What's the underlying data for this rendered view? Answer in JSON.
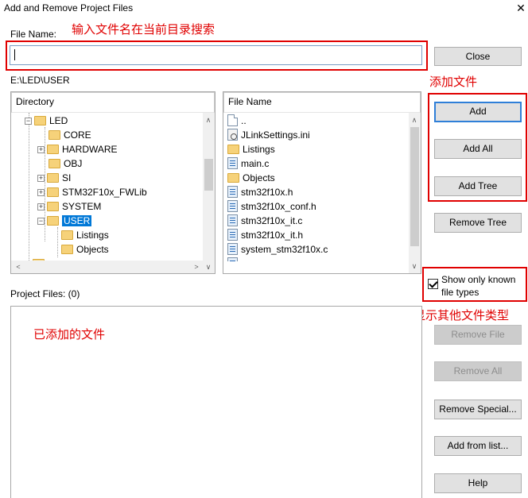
{
  "window": {
    "title": "Add and Remove Project Files",
    "close_glyph": "✕"
  },
  "annotations": {
    "filename": "输入文件名在当前目录搜索",
    "add_file": "添加文件",
    "filetype": "选择显示其他文件类型",
    "added": "已添加的文件"
  },
  "file_name": {
    "label": "File Name:",
    "value": ""
  },
  "current_path": "E:\\LED\\USER",
  "directory": {
    "header": "Directory",
    "items": [
      {
        "label": "LED",
        "expander": "−"
      },
      {
        "label": "CORE",
        "expander": ""
      },
      {
        "label": "HARDWARE",
        "expander": "+"
      },
      {
        "label": "OBJ",
        "expander": ""
      },
      {
        "label": "SI",
        "expander": "+"
      },
      {
        "label": "STM32F10x_FWLib",
        "expander": "+"
      },
      {
        "label": "SYSTEM",
        "expander": "+"
      },
      {
        "label": "USER",
        "expander": "−",
        "selected": true
      },
      {
        "label": "Listings",
        "expander": ""
      },
      {
        "label": "Objects",
        "expander": ""
      }
    ]
  },
  "files": {
    "header": "File Name",
    "items": [
      {
        "label": "..",
        "icon": "blank-file-icon"
      },
      {
        "label": "JLinkSettings.ini",
        "icon": "settings-file-icon"
      },
      {
        "label": "Listings",
        "icon": "folder-icon"
      },
      {
        "label": "main.c",
        "icon": "c-file-icon"
      },
      {
        "label": "Objects",
        "icon": "folder-icon"
      },
      {
        "label": "stm32f10x.h",
        "icon": "c-file-icon"
      },
      {
        "label": "stm32f10x_conf.h",
        "icon": "c-file-icon"
      },
      {
        "label": "stm32f10x_it.c",
        "icon": "c-file-icon"
      },
      {
        "label": "stm32f10x_it.h",
        "icon": "c-file-icon"
      },
      {
        "label": "system_stm32f10x.c",
        "icon": "c-file-icon"
      }
    ]
  },
  "buttons": {
    "close": "Close",
    "add": "Add",
    "add_all": "Add All",
    "add_tree": "Add Tree",
    "remove_tree": "Remove Tree",
    "remove_file": "Remove File",
    "remove_all": "Remove All",
    "remove_special": "Remove Special...",
    "add_from_list": "Add from list...",
    "help": "Help"
  },
  "show_known": {
    "label_line1": "Show only known",
    "label_line2": "file types",
    "checked": true
  },
  "project_files": {
    "label": "Project Files: (0)"
  },
  "scroll_glyphs": {
    "up": "∧",
    "down": "∨",
    "left": "<",
    "right": ">"
  },
  "colors": {
    "annotation_red": "#e00000",
    "selection_blue": "#0078d7",
    "default_button_border": "#2f7fd8"
  }
}
